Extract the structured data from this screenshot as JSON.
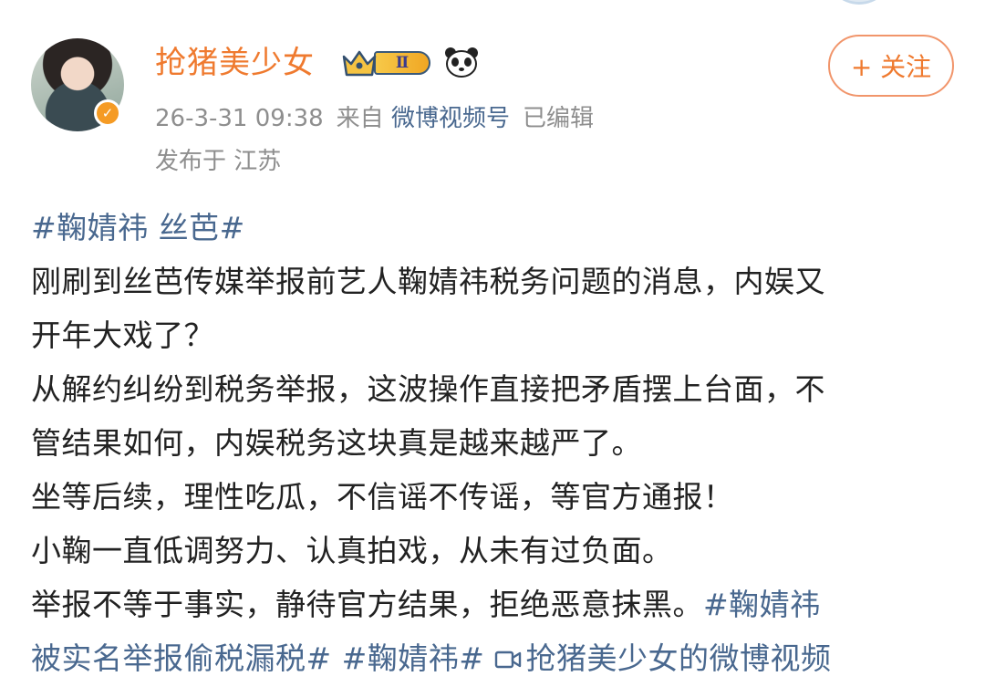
{
  "user": {
    "name": "抢猪美少女",
    "vip_level": "Ⅱ"
  },
  "follow_label": "+ 关注",
  "meta": {
    "time": "26-3-31 09:38",
    "from_prefix": "来自",
    "source": "微博视频号",
    "edited": "已编辑",
    "location": "发布于 江苏"
  },
  "post": {
    "hashtag_title": "#鞠婧祎 丝芭#",
    "lines": [
      "刚刷到丝芭传媒举报前艺人鞠婧祎税务问题的消息，内娱又",
      "开年大戏了？",
      "从解约纠纷到税务举报，这波操作直接把矛盾摆上台面，不",
      "管结果如何，内娱税务这块真是越来越严了。",
      "坐等后续，理性吃瓜，不信谣不传谣，等官方通报！",
      "小鞠一直低调努力、认真拍戏，从未有过负面。",
      "举报不等于事实，静待官方结果，拒绝恶意抹黑。"
    ],
    "tag_1_part1": "#鞠婧祎",
    "tag_1_part2": "被实名举报偷税漏税#",
    "tag_2": "#鞠婧祎#",
    "video_link": "抢猪美少女的微博视频"
  },
  "colors": {
    "username": "#ef7a2f",
    "link": "#49688f",
    "meta": "#8e8e8e",
    "text": "#222222",
    "verify": "#f59b24"
  },
  "icons": [
    "verified-badge-icon",
    "vip-crown-icon",
    "panda-icon",
    "video-camera-icon"
  ]
}
